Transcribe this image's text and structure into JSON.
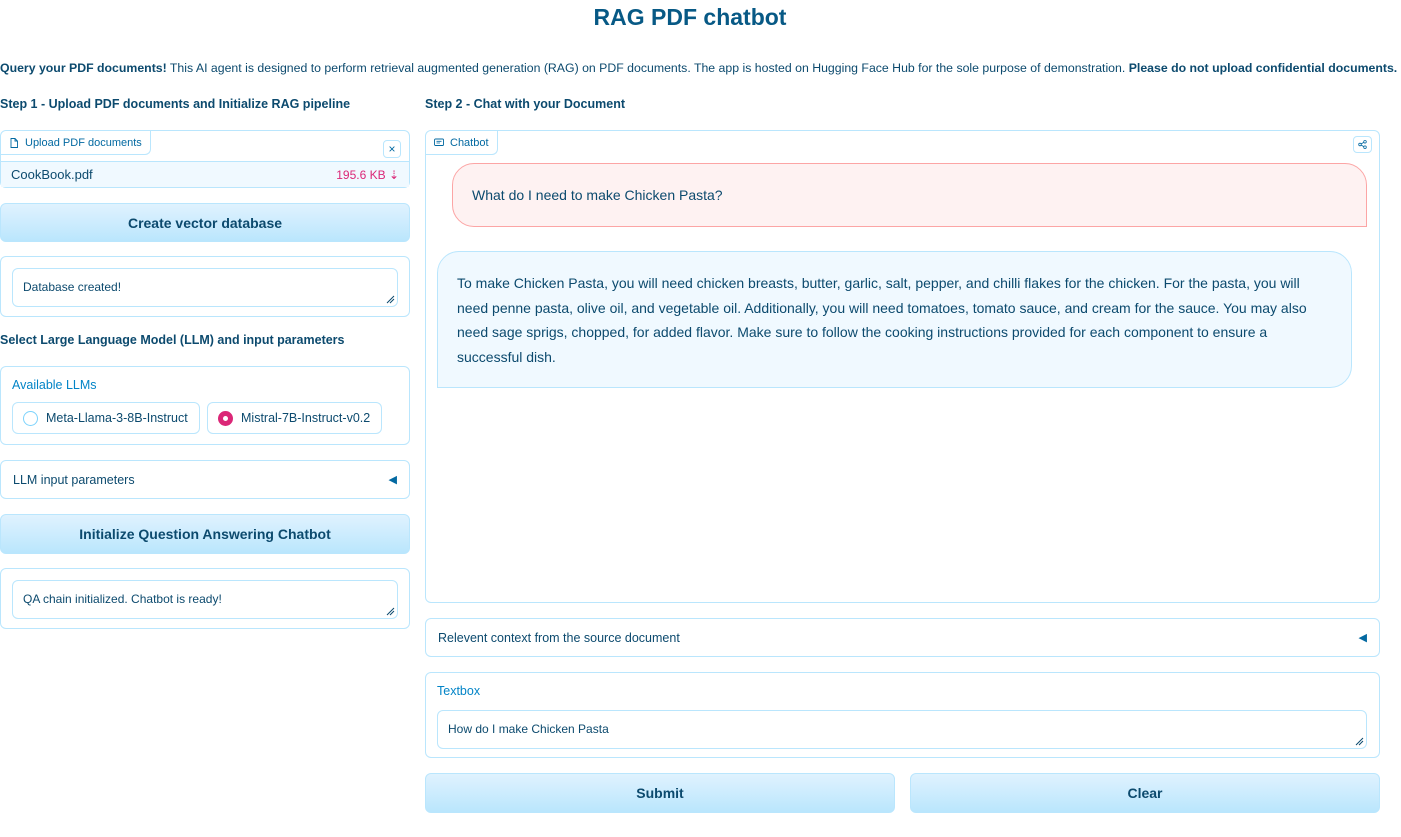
{
  "page": {
    "title": "RAG PDF chatbot",
    "intro_bold_1": "Query your PDF documents!",
    "intro_text": " This AI agent is designed to perform retrieval augmented generation (RAG) on PDF documents. The app is hosted on Hugging Face Hub for the sole purpose of demonstration. ",
    "intro_bold_2": "Please do not upload confidential documents."
  },
  "step1": {
    "heading": "Step 1 - Upload PDF documents and Initialize RAG pipeline",
    "upload": {
      "label": "Upload PDF documents",
      "file_name": "CookBook.pdf",
      "file_size": "195.6 KB ⇣"
    },
    "create_db_button": "Create vector database",
    "db_status": "Database created!",
    "llm_heading": "Select Large Language Model (LLM) and input parameters",
    "llm_group_label": "Available LLMs",
    "llm_options": [
      "Meta-Llama-3-8B-Instruct",
      "Mistral-7B-Instruct-v0.2"
    ],
    "llm_selected": "Mistral-7B-Instruct-v0.2",
    "llm_params_label": "LLM input parameters",
    "init_button": "Initialize Question Answering Chatbot",
    "qa_status": "QA chain initialized. Chatbot is ready!"
  },
  "step2": {
    "heading": "Step 2 - Chat with your Document",
    "chatbot_label": "Chatbot",
    "messages": [
      {
        "role": "user",
        "text": "What do I need to make Chicken Pasta?"
      },
      {
        "role": "assistant",
        "text": "To make Chicken Pasta, you will need chicken breasts, butter, garlic, salt, pepper, and chilli flakes for the chicken. For the pasta, you will need penne pasta, olive oil, and vegetable oil. Additionally, you will need tomatoes, tomato sauce, and cream for the sauce. You may also need sage sprigs, chopped, for added flavor. Make sure to follow the cooking instructions provided for each component to ensure a successful dish."
      }
    ],
    "context_label": "Relevent context from the source document",
    "textbox_label": "Textbox",
    "textbox_value": "How do I make Chicken Pasta",
    "submit_button": "Submit",
    "clear_button": "Clear"
  },
  "colors": {
    "primary_text": "#0c4a6e",
    "border": "#bae6fd",
    "button_bg": "#bae6fd",
    "user_bubble": "#fef2f2",
    "bot_bubble": "#f0f9ff",
    "radio_selected": "#db2777",
    "file_size": "#db2777"
  },
  "icons": [
    "file-icon",
    "close-icon",
    "chat-icon",
    "share-icon",
    "caret-left-icon",
    "resize-handle-icon"
  ]
}
